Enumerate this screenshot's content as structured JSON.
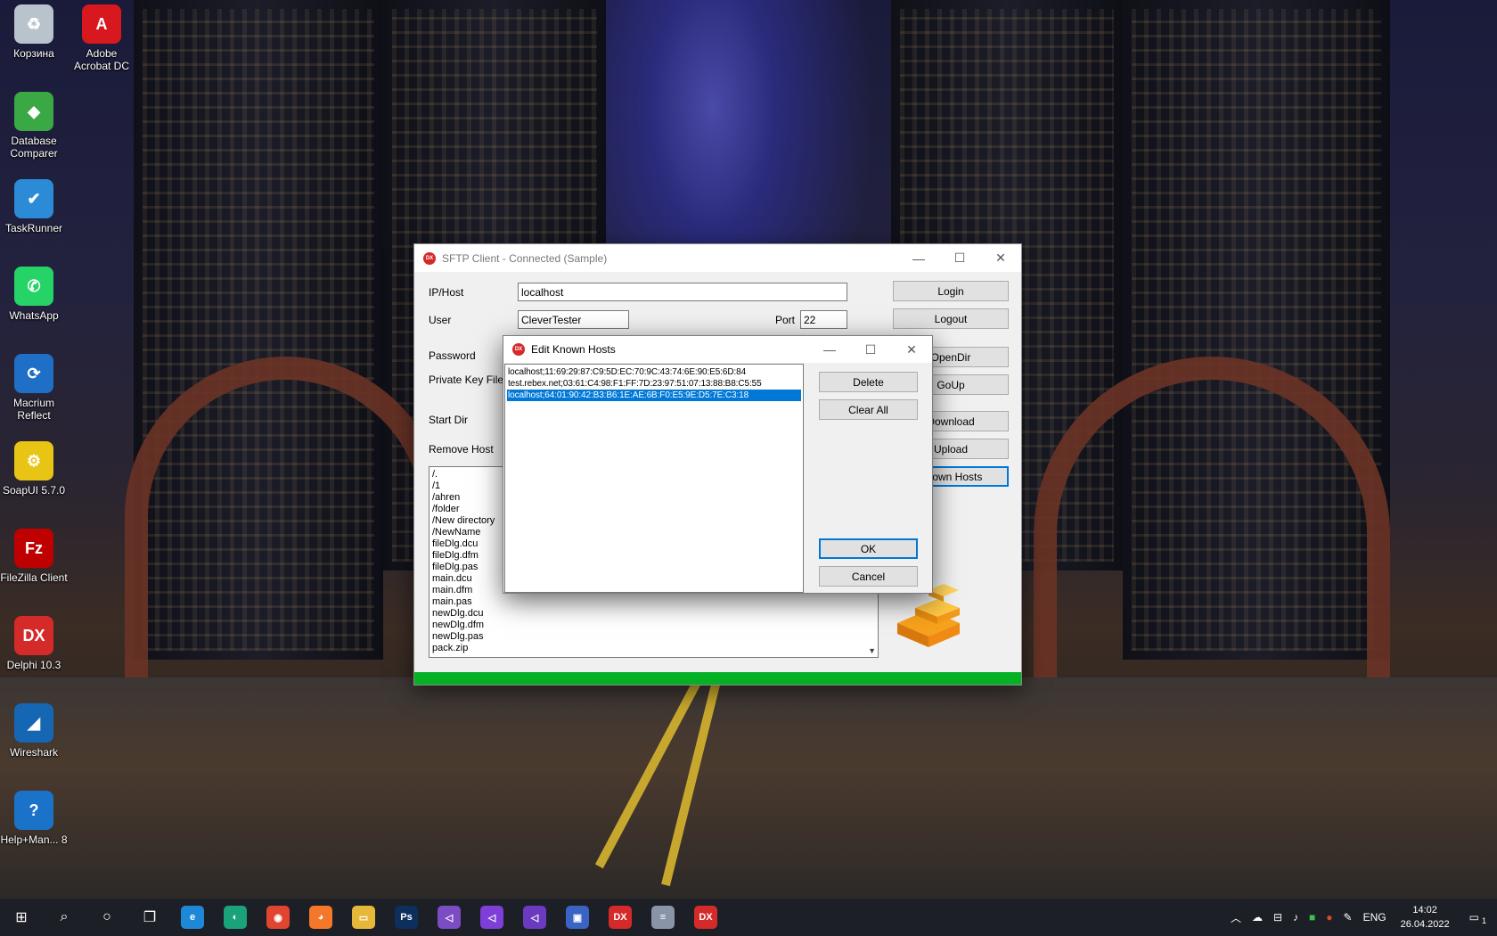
{
  "desktop_icons": [
    {
      "label": "Корзина",
      "icon": "recycle-bin-icon",
      "color": "#b9c3cc",
      "glyph": "♻"
    },
    {
      "label": "Adobe Acrobat DC",
      "icon": "acrobat-icon",
      "color": "#d7181f",
      "glyph": "A"
    },
    {
      "label": "Database Comparer",
      "icon": "database-comparer-icon",
      "color": "#3aa844",
      "glyph": "◆"
    },
    {
      "label": "TaskRunner",
      "icon": "taskrunner-icon",
      "color": "#2b8bd6",
      "glyph": "✔"
    },
    {
      "label": "WhatsApp",
      "icon": "whatsapp-icon",
      "color": "#25d366",
      "glyph": "✆"
    },
    {
      "label": "Macrium Reflect",
      "icon": "macrium-reflect-icon",
      "color": "#1f6fc7",
      "glyph": "⟳"
    },
    {
      "label": "SoapUI 5.7.0",
      "icon": "soapui-icon",
      "color": "#e8c414",
      "glyph": "⚙"
    },
    {
      "label": "FileZilla Client",
      "icon": "filezilla-icon",
      "color": "#bf0000",
      "glyph": "Fz"
    },
    {
      "label": "Delphi 10.3",
      "icon": "delphi-icon",
      "color": "#d42a2a",
      "glyph": "DX"
    },
    {
      "label": "Wireshark",
      "icon": "wireshark-icon",
      "color": "#1667b3",
      "glyph": "◢"
    },
    {
      "label": "Help+Man... 8",
      "icon": "help-manual-icon",
      "color": "#1a73c9",
      "glyph": "?"
    }
  ],
  "sftp_window": {
    "title": "SFTP Client - Connected (Sample)",
    "logo": "DX",
    "labels": {
      "host": "IP/Host",
      "user": "User",
      "port": "Port",
      "password": "Password",
      "private_key": "Private Key File",
      "start_dir": "Start Dir",
      "remove_host": "Remove Host"
    },
    "values": {
      "host": "localhost",
      "user": "CleverTester",
      "port": "22"
    },
    "buttons": {
      "login": "Login",
      "logout": "Logout",
      "opendir": "OpenDir",
      "goup": "GoUp",
      "download": "Download",
      "upload": "Upload",
      "known_hosts": "Known Hosts"
    },
    "files": [
      "/.",
      "/1",
      "/ahren",
      "/folder",
      "/New directory",
      "/NewName",
      "fileDlg.dcu",
      "fileDlg.dfm",
      "fileDlg.pas",
      "main.dcu",
      "main.dfm",
      "main.pas",
      "newDlg.dcu",
      "newDlg.dfm",
      "newDlg.pas",
      "pack.zip"
    ],
    "progress_percent": 100,
    "progress_color": "#06b025"
  },
  "known_hosts_dialog": {
    "title": "Edit Known Hosts",
    "logo": "DX",
    "hosts": [
      "localhost;11:69:29:87:C9:5D:EC:70:9C:43:74:6E:90:E5:6D:84",
      "test.rebex.net;03:61:C4:98:F1:FF:7D:23:97:51:07:13:88:B8:C5:55",
      "localhost;64:01:90:42:B3:B6:1E:AE:6B:F0:E5:9E:D5:7E:C3:18"
    ],
    "selected_index": 2,
    "buttons": {
      "delete": "Delete",
      "clear_all": "Clear All",
      "ok": "OK",
      "cancel": "Cancel"
    }
  },
  "taskbar": {
    "apps": [
      {
        "name": "ie-icon",
        "color": "#1e88d8",
        "glyph": "e"
      },
      {
        "name": "edge-icon",
        "color": "#1aa27a",
        "glyph": "◐"
      },
      {
        "name": "chrome-icon",
        "color": "#e0452f",
        "glyph": "◉"
      },
      {
        "name": "firefox-icon",
        "color": "#f4772a",
        "glyph": "◕"
      },
      {
        "name": "file-explorer-icon",
        "color": "#e6b83a",
        "glyph": "▭"
      },
      {
        "name": "photoshop-icon",
        "color": "#0c2f5d",
        "glyph": "Ps"
      },
      {
        "name": "visual-studio-icon",
        "color": "#7b4cc4",
        "glyph": "◁"
      },
      {
        "name": "vscode-icon",
        "color": "#7e3fd8",
        "glyph": "◁"
      },
      {
        "name": "visual-studio-2-icon",
        "color": "#6a3ac0",
        "glyph": "◁"
      },
      {
        "name": "save-disk-icon",
        "color": "#3a64c4",
        "glyph": "▣"
      },
      {
        "name": "delphi-taskbar-icon",
        "color": "#d42a2a",
        "glyph": "DX"
      },
      {
        "name": "server-app-icon",
        "color": "#8a94a8",
        "glyph": "≡"
      },
      {
        "name": "delphi-app-running-icon",
        "color": "#d42a2a",
        "glyph": "DX"
      }
    ],
    "language": "ENG",
    "time": "14:02",
    "date": "26.04.2022",
    "notification_count": "1"
  }
}
